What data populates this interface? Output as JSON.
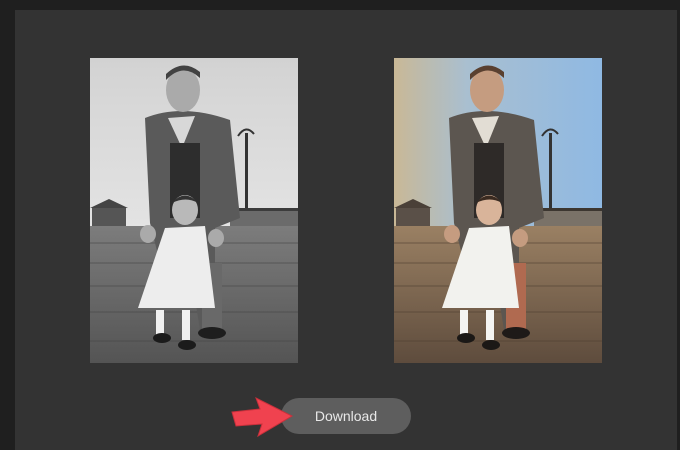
{
  "download_button": {
    "label": "Download"
  },
  "photos": {
    "original": {
      "style": "black-and-white"
    },
    "colorized": {
      "style": "color"
    }
  },
  "colors": {
    "page_background": "#1f1f1f",
    "panel_background": "#333333",
    "button_background": "#5e5e5e",
    "button_text": "#e8e8e8",
    "arrow": "#f0424f"
  },
  "icons": {
    "pointer": "red-arrow-icon"
  }
}
